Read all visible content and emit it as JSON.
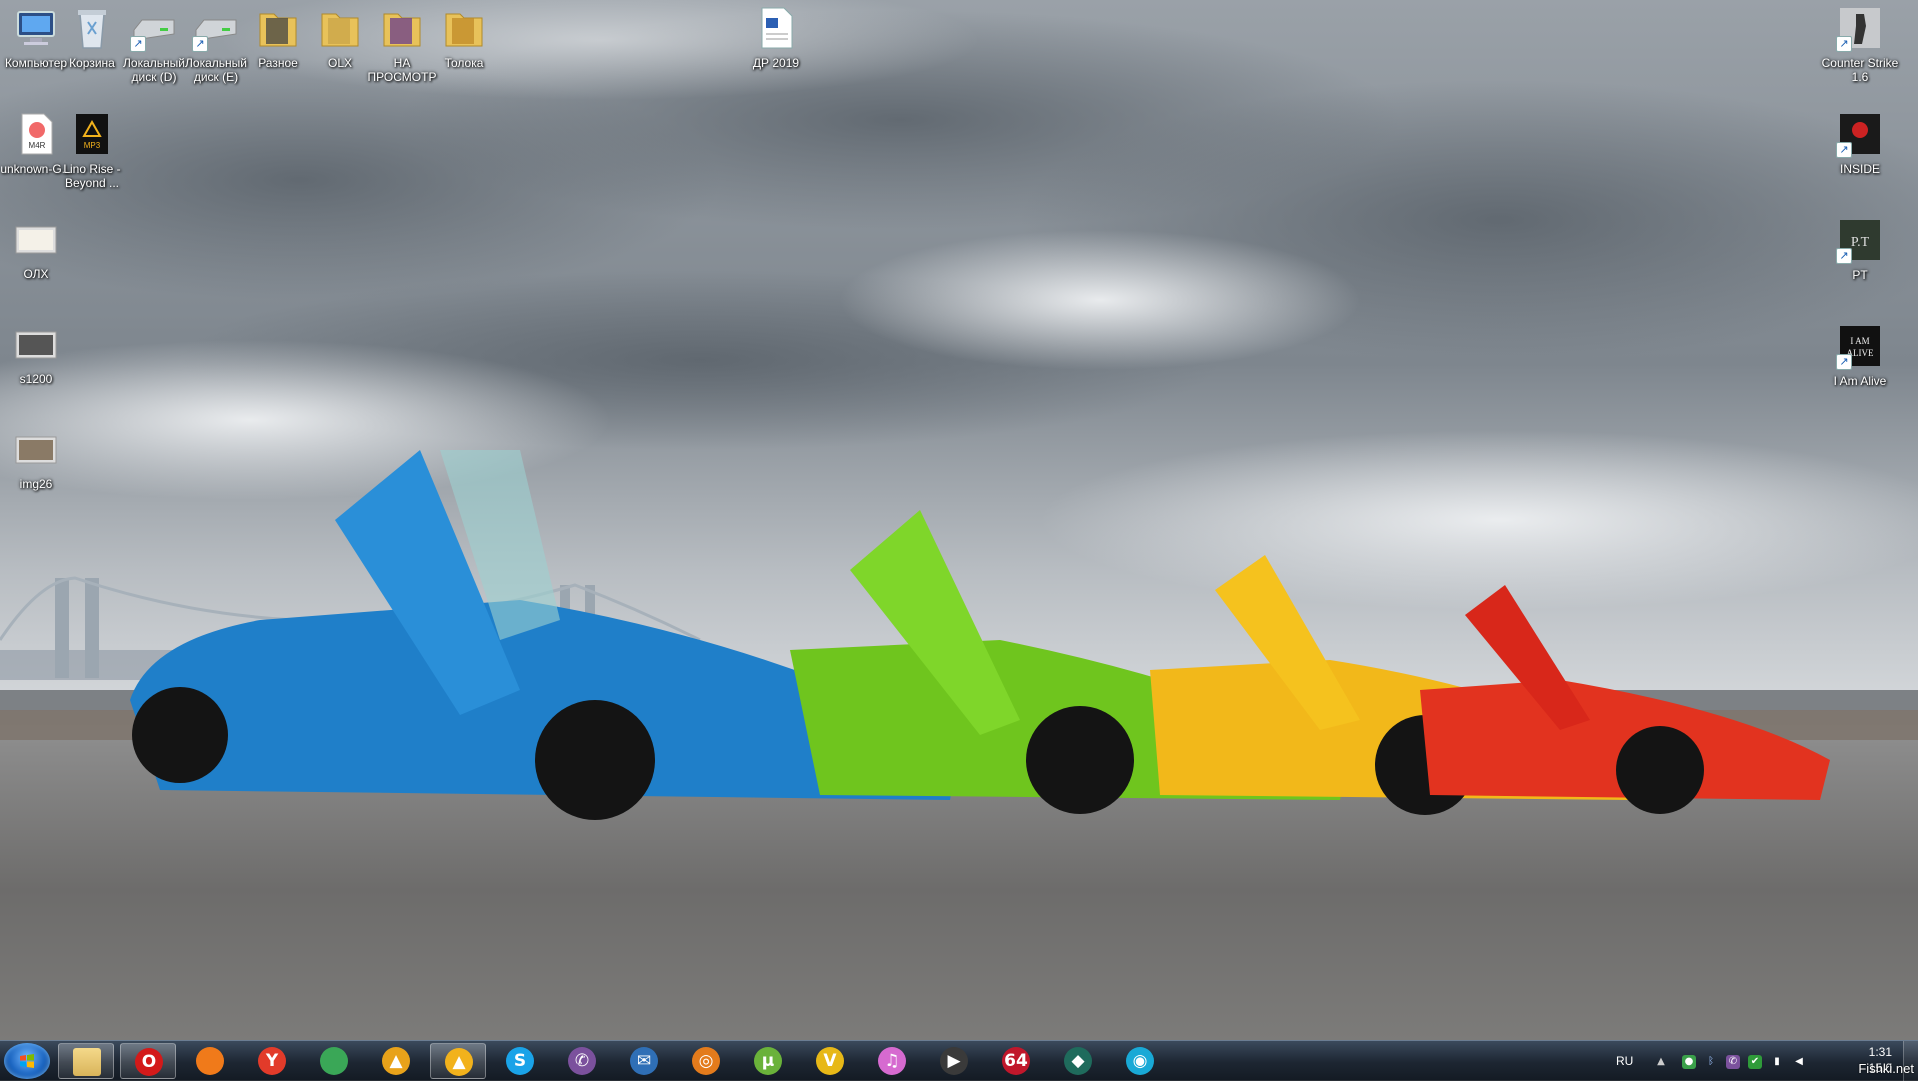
{
  "desktop": {
    "left_icons": [
      {
        "name": "computer-icon",
        "label": "Компьютер",
        "shortcut": false
      },
      {
        "name": "recycle-bin-icon",
        "label": "Корзина",
        "shortcut": false
      },
      {
        "name": "drive-icon",
        "label": "Локальный диск (D)",
        "shortcut": true
      },
      {
        "name": "drive-icon",
        "label": "Локальный диск (E)",
        "shortcut": true
      },
      {
        "name": "folder-icon",
        "label": "Разное",
        "shortcut": false
      },
      {
        "name": "folder-icon",
        "label": "OLX",
        "shortcut": false
      },
      {
        "name": "folder-icon",
        "label": "НА ПРОСМОТР",
        "shortcut": false
      },
      {
        "name": "folder-icon",
        "label": "Толока",
        "shortcut": false
      },
      {
        "name": "word-document-icon",
        "label": "ДР 2019",
        "shortcut": false
      },
      {
        "name": "m4r-file-icon",
        "label": "unknown-G...",
        "shortcut": false
      },
      {
        "name": "mp3-file-icon",
        "label": "Lino Rise - Beyond ...",
        "shortcut": false
      },
      {
        "name": "image-file-icon",
        "label": "ОЛХ",
        "shortcut": false
      },
      {
        "name": "image-file-icon",
        "label": "s1200",
        "shortcut": false
      },
      {
        "name": "image-file-icon",
        "label": "img26",
        "shortcut": false
      }
    ],
    "right_icons": [
      {
        "name": "counter-strike-icon",
        "label": "Counter Strike 1.6",
        "shortcut": true
      },
      {
        "name": "inside-game-icon",
        "label": "INSIDE",
        "shortcut": true
      },
      {
        "name": "pt-game-icon",
        "label": "PT",
        "shortcut": true
      },
      {
        "name": "i-am-alive-game-icon",
        "label": "I Am Alive",
        "shortcut": true
      }
    ]
  },
  "taskbar": {
    "pinned": [
      {
        "name": "explorer-icon",
        "glyph": "",
        "color": "#d9b45a",
        "active": true
      },
      {
        "name": "opera-icon",
        "glyph": "O",
        "color": "#d31a1a",
        "active": true
      },
      {
        "name": "firefox-icon",
        "glyph": "",
        "color": "#f07a1a",
        "active": false
      },
      {
        "name": "yandex-browser-icon",
        "glyph": "Y",
        "color": "#e23b2a",
        "active": false
      },
      {
        "name": "chrome-icon",
        "glyph": "",
        "color": "#3aa757",
        "active": false
      },
      {
        "name": "aimp-icon",
        "glyph": "▲",
        "color": "#e8a21a",
        "active": false
      },
      {
        "name": "aimp-active-icon",
        "glyph": "▲",
        "color": "#f2b21c",
        "active": true
      },
      {
        "name": "skype-icon",
        "glyph": "S",
        "color": "#1aa3e8",
        "active": false
      },
      {
        "name": "viber-icon",
        "glyph": "✆",
        "color": "#7b519d",
        "active": false
      },
      {
        "name": "thunderbird-icon",
        "glyph": "✉",
        "color": "#2f6fb6",
        "active": false
      },
      {
        "name": "origin-icon",
        "glyph": "◎",
        "color": "#e37b1c",
        "active": false
      },
      {
        "name": "utorrent-icon",
        "glyph": "µ",
        "color": "#6ab23a",
        "active": false
      },
      {
        "name": "vectir-icon",
        "glyph": "V",
        "color": "#e7b817",
        "active": false
      },
      {
        "name": "itunes-icon",
        "glyph": "♫",
        "color": "#d66ad0",
        "active": false
      },
      {
        "name": "playstation-icon",
        "glyph": "▶",
        "color": "#3a3a3a",
        "active": false
      },
      {
        "name": "aida64-icon",
        "glyph": "64",
        "color": "#c0172b",
        "active": false
      },
      {
        "name": "vpn-icon",
        "glyph": "◆",
        "color": "#1f6b5c",
        "active": false
      },
      {
        "name": "wifi-hotspot-icon",
        "glyph": "◉",
        "color": "#19a9d6",
        "active": false
      }
    ],
    "tray": {
      "language": "RU",
      "clock_time": "1:31",
      "clock_date": "15.0"
    }
  },
  "watermark": "Fishki.net"
}
